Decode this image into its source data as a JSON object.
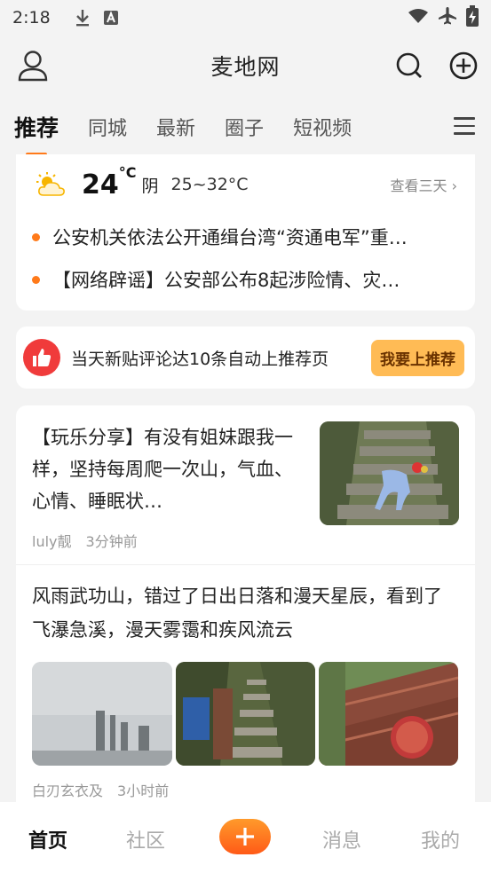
{
  "status_bar": {
    "time": "2:18"
  },
  "header": {
    "title": "麦地网"
  },
  "tabs": [
    {
      "label": "推荐",
      "active": true
    },
    {
      "label": "同城"
    },
    {
      "label": "最新"
    },
    {
      "label": "圈子"
    },
    {
      "label": "短视频"
    }
  ],
  "weather": {
    "temp": "24",
    "unit": "°C",
    "condition": "阴",
    "range": "25~32°C",
    "forecast_link": "查看三天 ›"
  },
  "news": [
    "公安机关依法公开通缉台湾“资通电军”重…",
    "【网络辟谣】公安部公布8起涉险情、灾…"
  ],
  "promo": {
    "text": "当天新贴评论达10条自动上推荐页",
    "button": "我要上推荐"
  },
  "posts": [
    {
      "title": "【玩乐分享】有没有姐妹跟我一样，坚持每周爬一次山，气血、心情、睡眠状…",
      "author": "luly靓",
      "time": "3分钟前"
    },
    {
      "title": "风雨武功山，错过了日出日落和漫天星辰，看到了飞瀑急溪，漫天雾霭和疾风流云",
      "author": "白刃玄衣及",
      "time": "3小时前"
    }
  ],
  "bottom_nav": [
    {
      "label": "首页",
      "active": true
    },
    {
      "label": "社区"
    },
    {
      "label": "消息"
    },
    {
      "label": "我的"
    }
  ],
  "colors": {
    "accent": "#ff7a1a",
    "promo_red": "#f03b3b",
    "promo_button": "#ffbb55"
  }
}
